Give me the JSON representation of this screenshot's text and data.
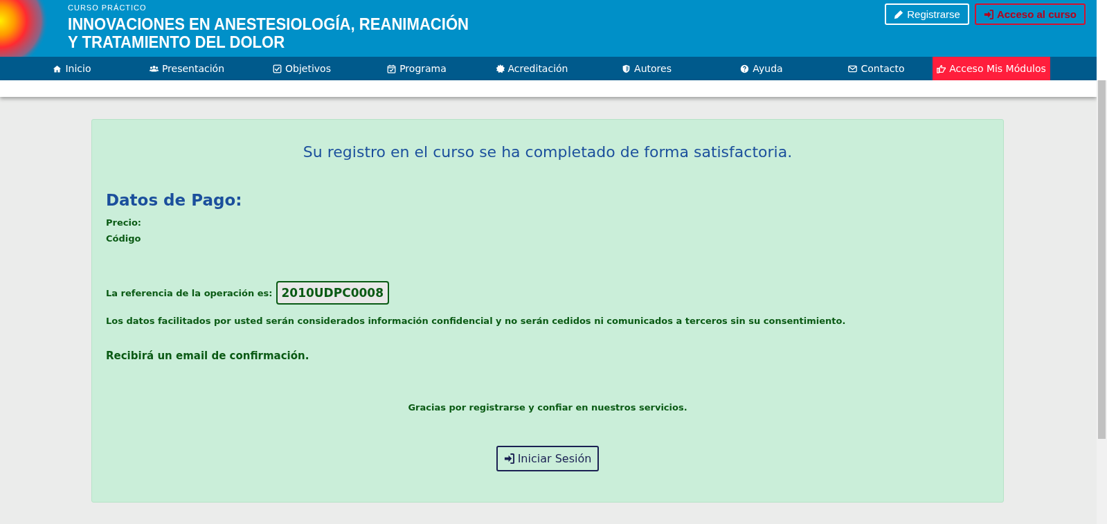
{
  "header": {
    "kicker": "CURSO PRÁCTICO",
    "title_lines": [
      "INNOVACIONES EN ANESTESIOLOGÍA, REANIMACIÓN",
      "Y TRATAMIENTO DEL DOLOR"
    ],
    "buttons": [
      {
        "label": "Registrarse",
        "kind": "outline"
      },
      {
        "label": "Acceso al curso",
        "kind": "danger"
      }
    ]
  },
  "nav": [
    {
      "label": "Inicio",
      "kind": "link"
    },
    {
      "label": "Presentación",
      "kind": "link"
    },
    {
      "label": "Objetivos",
      "kind": "link"
    },
    {
      "label": "Programa",
      "kind": "link"
    },
    {
      "label": "Acreditación",
      "kind": "link"
    },
    {
      "label": "Autores",
      "kind": "link"
    },
    {
      "label": "Ayuda",
      "kind": "link"
    },
    {
      "label": "Contacto",
      "kind": "link"
    },
    {
      "label": "Acceso Mis Módulos",
      "kind": "cta"
    }
  ],
  "card": {
    "message": "Su registro en el curso se ha completado de forma satisfactoria.",
    "heading": "Datos de Pago:",
    "fields": [
      "Precio:",
      "Código"
    ],
    "reference_label": "La referencia de la operación es:",
    "reference": "2010UDPC0008",
    "privacy": "Los datos facilitados por usted serán considerados información confidencial y no serán cedidos ni comunicados a terceros sin su consentimiento.",
    "email_note": "Recibirá un email de confirmación.",
    "thanks": "Gracias por registrarse y confiar en nuestros servicios.",
    "login_button": "Iniciar Sesión"
  }
}
